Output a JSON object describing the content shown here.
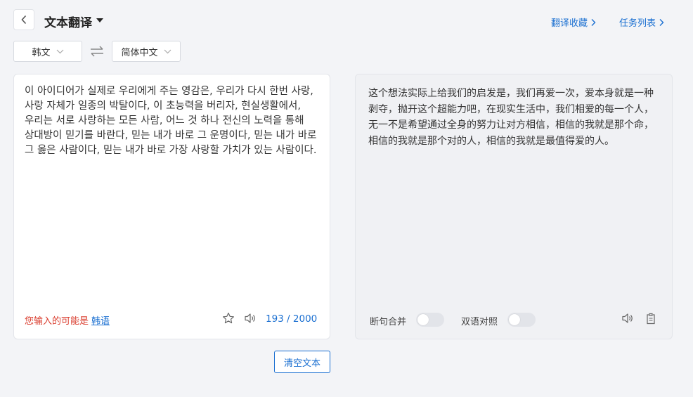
{
  "header": {
    "title": "文本翻译",
    "links": {
      "favorites": "翻译收藏",
      "tasks": "任务列表"
    }
  },
  "languages": {
    "source": "韩文",
    "target": "简体中文"
  },
  "source_panel": {
    "text": "이 아이디어가 실제로 우리에게 주는 영감은, 우리가 다시 한번 사랑, 사랑 자체가 일종의 박탈이다, 이 초능력을 버리자, 현실생활에서, 우리는 서로 사랑하는 모든 사람, 어느 것 하나 전신의 노력을 통해 상대방이 믿기를 바란다, 믿는 내가 바로 그 운명이다, 믿는 내가 바로 그 옳은 사람이다, 믿는 내가 바로 가장 사랑할 가치가 있는 사람이다.",
    "detect_hint": "您输入的可能是",
    "detect_lang": "韩语",
    "counter": "193 / 2000"
  },
  "target_panel": {
    "text": "这个想法实际上给我们的启发是，我们再爱一次，爱本身就是一种剥夺，抛开这个超能力吧，在现实生活中，我们相爱的每一个人，无一不是希望通过全身的努力让对方相信，相信的我就是那个命，相信的我就是那个对的人，相信的我就是最值得爱的人。",
    "toggle_sentence_merge": "断句合并",
    "toggle_bilingual": "双语对照"
  },
  "actions": {
    "clear": "清空文本"
  },
  "colors": {
    "accent": "#1a6fd1",
    "warning": "#d93a2b"
  },
  "icons": [
    "back-chevron-icon",
    "caret-down-icon",
    "chevron-right-icon",
    "swap-icon",
    "star-icon",
    "speaker-icon",
    "copy-icon"
  ]
}
